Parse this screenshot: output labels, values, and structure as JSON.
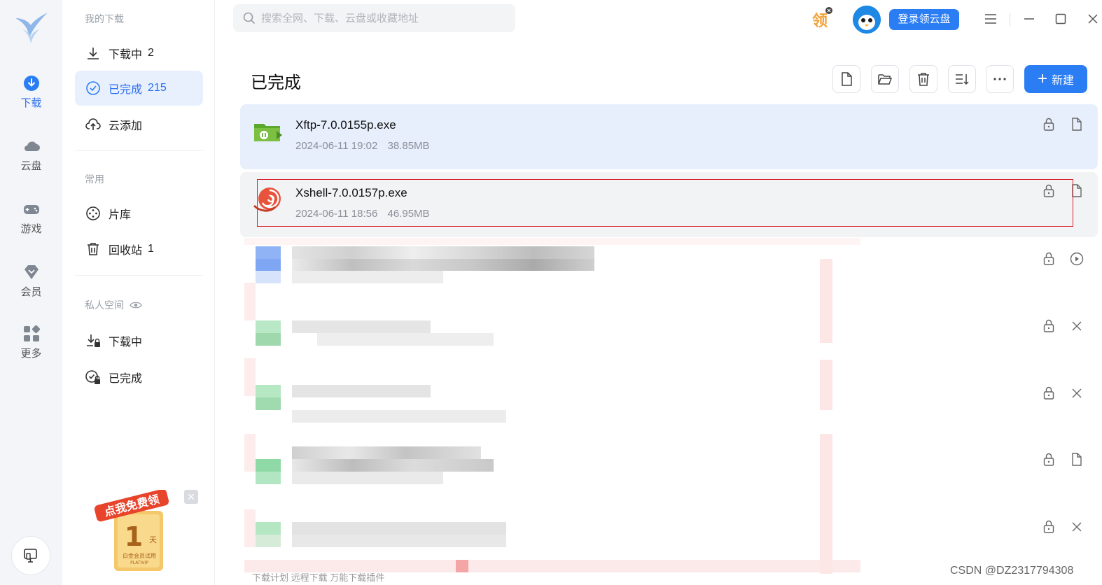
{
  "rail": {
    "items": [
      {
        "label": "下载",
        "icon": "download-icon",
        "active": true
      },
      {
        "label": "云盘",
        "icon": "cloud-icon"
      },
      {
        "label": "游戏",
        "icon": "gamepad-icon"
      },
      {
        "label": "会员",
        "icon": "diamond-icon"
      },
      {
        "label": "更多",
        "icon": "grid-icon"
      }
    ]
  },
  "sidebar": {
    "section1": "我的下载",
    "downloading": {
      "label": "下载中",
      "count": "2"
    },
    "completed": {
      "label": "已完成",
      "count": "215"
    },
    "cloud_add": {
      "label": "云添加"
    },
    "section2": "常用",
    "library": {
      "label": "片库"
    },
    "recycle": {
      "label": "回收站",
      "count": "1"
    },
    "section3": "私人空间",
    "private_downloading": {
      "label": "下载中"
    },
    "private_completed": {
      "label": "已完成"
    },
    "promo": {
      "line1": "点我免费领",
      "days": "1",
      "unit": "天",
      "sub": "白金会员试用",
      "tag": "PLATIVIP"
    }
  },
  "topbar": {
    "search_placeholder": "搜索全网、下载、云盘或收藏地址",
    "login_label": "登录领云盘",
    "gift_label": "领"
  },
  "main": {
    "title": "已完成",
    "new_label": "新建",
    "files": [
      {
        "name": "Xftp-7.0.0155p.exe",
        "date": "2024-06-11 19:02",
        "size": "38.85MB"
      },
      {
        "name": "Xshell-7.0.0157p.exe",
        "date": "2024-06-11 18:56",
        "size": "46.95MB"
      }
    ],
    "bottom_links": "下载计划    远程下载    万能下载插件"
  },
  "watermark": "CSDN @DZ2317794308",
  "colors": {
    "accent": "#2b7df3",
    "selection": "#e8effc",
    "highlight_border": "#d9232f"
  }
}
